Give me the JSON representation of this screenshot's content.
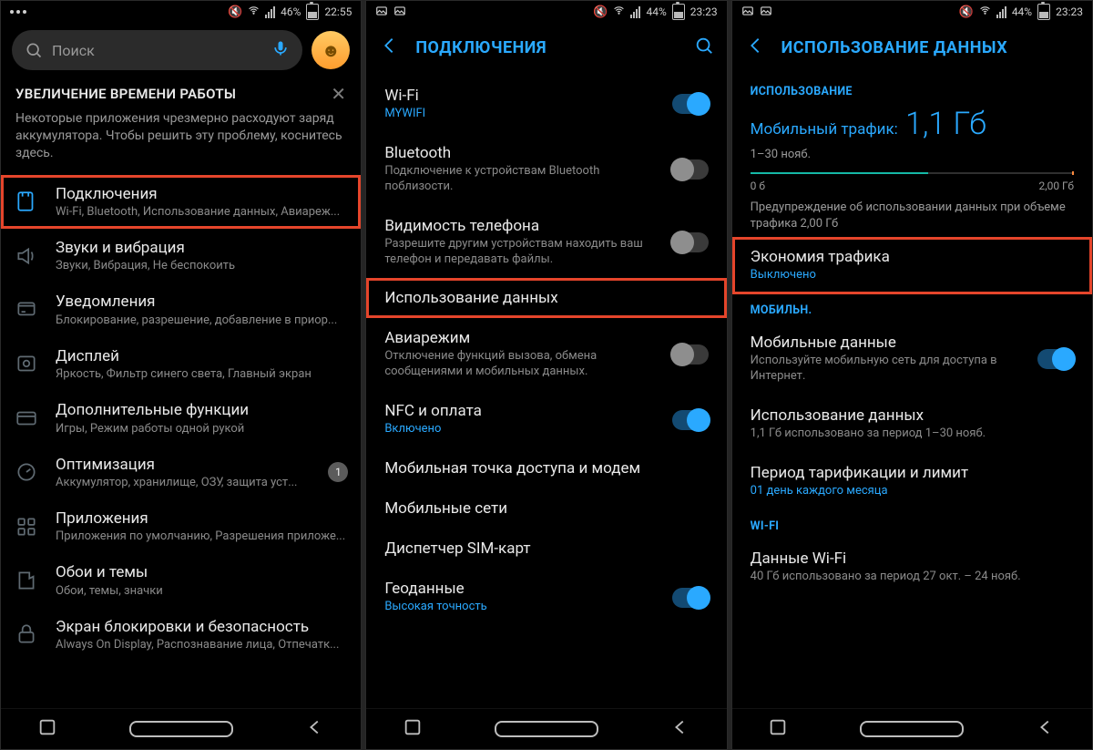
{
  "screen1": {
    "status": {
      "battery": "46%",
      "time": "22:55"
    },
    "search_placeholder": "Поиск",
    "notice": {
      "title": "УВЕЛИЧЕНИЕ ВРЕМЕНИ РАБОТЫ",
      "body": "Некоторые приложения чрезмерно расходуют заряд аккумулятора. Чтобы решить эту проблему, коснитесь здесь."
    },
    "items": [
      {
        "title": "Подключения",
        "sub": "Wi-Fi, Bluetooth, Использование данных, Авиареж..."
      },
      {
        "title": "Звуки и вибрация",
        "sub": "Звуки, Вибрация, Не беспокоить"
      },
      {
        "title": "Уведомления",
        "sub": "Блокирование, разрешение, добавление в приор..."
      },
      {
        "title": "Дисплей",
        "sub": "Яркость, Фильтр синего света, Главный экран"
      },
      {
        "title": "Дополнительные функции",
        "sub": "Игры, Режим работы одной рукой"
      },
      {
        "title": "Оптимизация",
        "sub": "Аккумулятор, хранилище, ОЗУ, защита уст...",
        "badge": "1"
      },
      {
        "title": "Приложения",
        "sub": "Приложения по умолчанию, Разрешения приложе..."
      },
      {
        "title": "Обои и темы",
        "sub": "Обои, темы, значки"
      },
      {
        "title": "Экран блокировки и безопасность",
        "sub": "Always On Display, Распознавание лица, Отпечатк..."
      }
    ]
  },
  "screen2": {
    "status": {
      "battery": "44%",
      "time": "23:23"
    },
    "header": "ПОДКЛЮЧЕНИЯ",
    "items": [
      {
        "title": "Wi-Fi",
        "sub": "MYWIFI",
        "sub_blue": true,
        "toggle": "on"
      },
      {
        "title": "Bluetooth",
        "sub": "Подключение к устройствам Bluetooth поблизости.",
        "toggle": "off"
      },
      {
        "title": "Видимость телефона",
        "sub": "Разрешите другим устройствам находить ваш телефон и передавать файлы.",
        "toggle": "off"
      },
      {
        "title": "Использование данных"
      },
      {
        "title": "Авиарежим",
        "sub": "Отключение функций вызова, обмена сообщениями и мобильных данных.",
        "toggle": "off"
      },
      {
        "title": "NFC и оплата",
        "sub": "Включено",
        "sub_blue": true,
        "toggle": "on"
      },
      {
        "title": "Мобильная точка доступа и модем"
      },
      {
        "title": "Мобильные сети"
      },
      {
        "title": "Диспетчер SIM-карт"
      },
      {
        "title": "Геоданные",
        "sub": "Высокая точность",
        "sub_blue": true,
        "toggle": "on"
      }
    ]
  },
  "screen3": {
    "status": {
      "battery": "44%",
      "time": "23:23"
    },
    "header": "ИСПОЛЬЗОВАНИЕ ДАННЫХ",
    "section_usage": "ИСПОЛЬЗОВАНИЕ",
    "usage": {
      "label": "Мобильный трафик:",
      "value": "1,1 Гб",
      "range": "1–30 нояб.",
      "min": "0 б",
      "max": "2,00 Гб"
    },
    "warning_text": "Предупреждение об использовании данных при объеме трафика 2,00 Гб",
    "saver": {
      "title": "Экономия трафика",
      "sub": "Выключено"
    },
    "section_mobile": "МОБИЛЬН.",
    "mobile_data": {
      "title": "Мобильные данные",
      "sub": "Используйте мобильную сеть для доступа в Интернет."
    },
    "mobile_usage": {
      "title": "Использование данных",
      "sub": "1,1 Гб использовано за период 1–30 нояб."
    },
    "billing": {
      "title": "Период тарификации и лимит",
      "sub": "01 день каждого месяца"
    },
    "section_wifi": "WI-FI",
    "wifi_data": {
      "title": "Данные Wi-Fi",
      "sub": "40 Гб использовано за период 27 окт. – 24 нояб."
    }
  }
}
